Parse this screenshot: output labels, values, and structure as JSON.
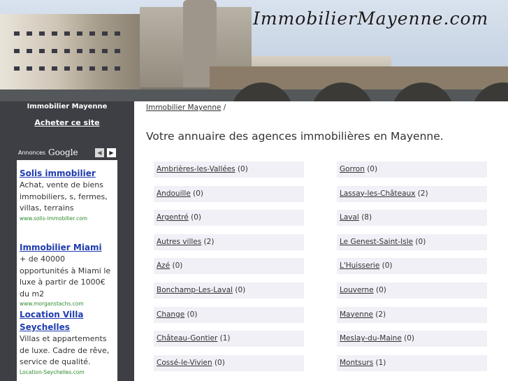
{
  "brand": "ImmobilierMayenne.com",
  "sidebar": {
    "title": "Immobilier Mayenne",
    "buy_link": "Acheter ce site",
    "ads_label": "Annonces",
    "ads_provider": "Google",
    "ads": [
      {
        "title": "Solis immobilier",
        "text": "Achat, vente de biens immobiliers, s, fermes, villas, terrains",
        "url": "www.solis-immobilier.com"
      },
      {
        "title": "Immobilier Miami",
        "text": "+ de 40000 opportunités à Miami le luxe à partir de 1000€ du m2",
        "url": "www.morganstachs.com"
      },
      {
        "title": "Location Villa Seychelles",
        "text": "Villas et appartements de luxe. Cadre de rêve, service de qualité.",
        "url": "Location-Seychelles.com"
      }
    ]
  },
  "breadcrumb": {
    "home": "Immobilier Mayenne",
    "sep": "/"
  },
  "heading": "Votre annuaire des agences immobilières en Mayenne.",
  "directory": {
    "left": [
      {
        "name": "Ambrières-les-Vallées",
        "count": "(0)"
      },
      {
        "name": "Andouille",
        "count": "(0)"
      },
      {
        "name": "Argentré",
        "count": "(0)"
      },
      {
        "name": "Autres villes",
        "count": "(2)"
      },
      {
        "name": "Azé",
        "count": "(0)"
      },
      {
        "name": "Bonchamp-Les-Laval",
        "count": "(0)"
      },
      {
        "name": "Change",
        "count": "(0)"
      },
      {
        "name": "Château-Gontier",
        "count": "(1)"
      },
      {
        "name": "Cossé-le-Vivien",
        "count": "(0)"
      }
    ],
    "right": [
      {
        "name": "Gorron",
        "count": "(0)"
      },
      {
        "name": "Lassay-les-Châteaux",
        "count": "(2)"
      },
      {
        "name": "Laval",
        "count": "(8)"
      },
      {
        "name": "Le Genest-Saint-Isle",
        "count": "(0)"
      },
      {
        "name": "L'Huisserie",
        "count": "(0)"
      },
      {
        "name": "Louverne",
        "count": "(0)"
      },
      {
        "name": "Mayenne",
        "count": "(2)"
      },
      {
        "name": "Meslay-du-Maine",
        "count": "(0)"
      },
      {
        "name": "Montsurs",
        "count": "(1)"
      }
    ]
  },
  "colors": {
    "sidebar_bg": "#3d3f45",
    "link": "#1f3cb0",
    "ad_url": "#2e8b2e",
    "cell_bg": "#f1f0f6"
  }
}
